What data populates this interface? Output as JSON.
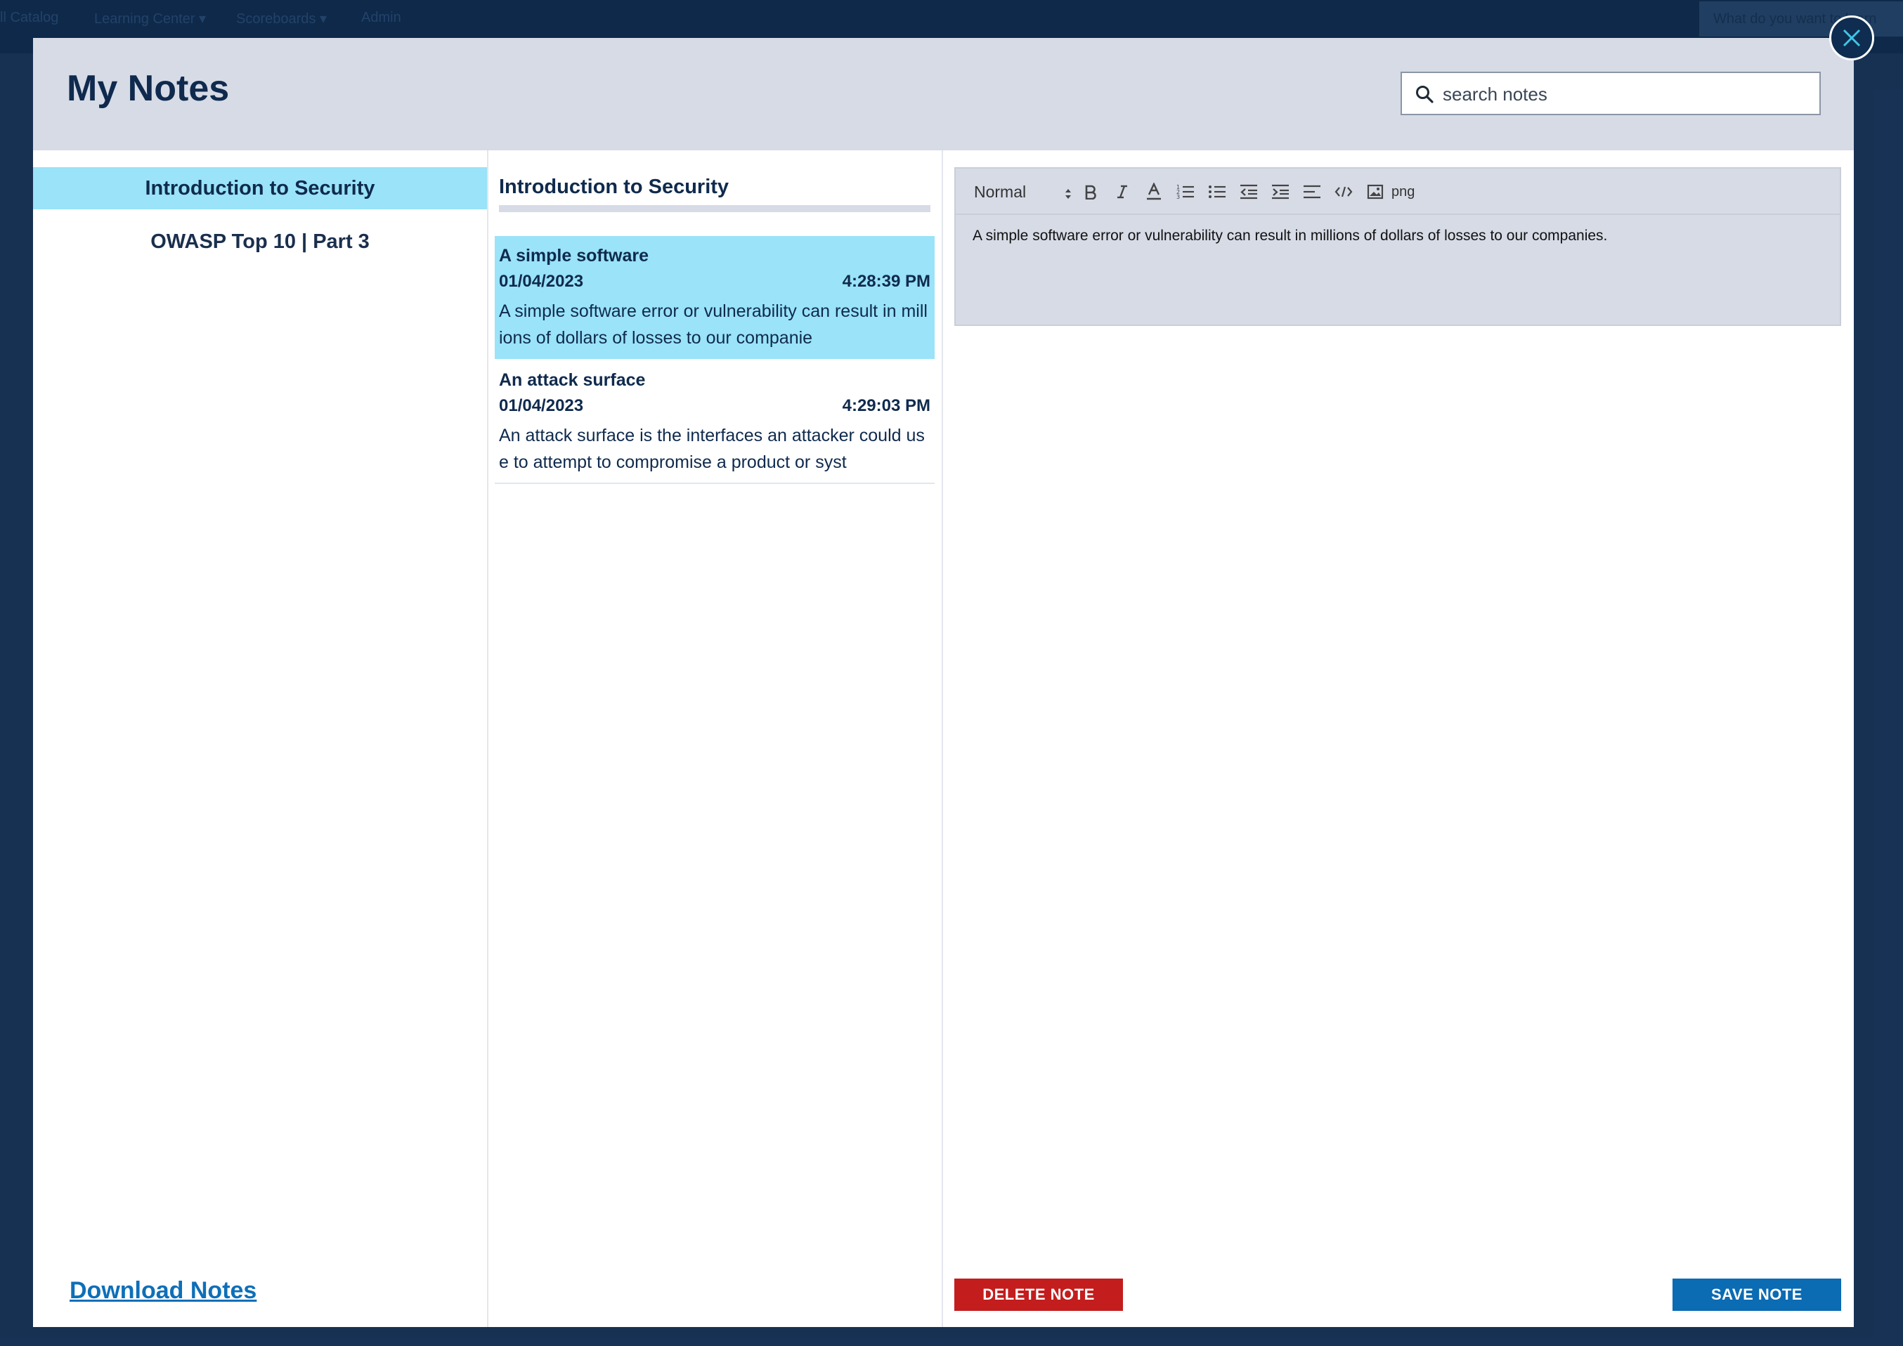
{
  "background_nav": {
    "items": [
      "ll Catalog",
      "Learning Center ▾",
      "Scoreboards ▾",
      "Admin"
    ],
    "search_placeholder": "What do you want to learn"
  },
  "modal": {
    "title": "My Notes",
    "search": {
      "placeholder": "search notes",
      "value": ""
    },
    "close_icon": "close-icon"
  },
  "courses": {
    "items": [
      {
        "label": "Introduction to Security",
        "active": true
      },
      {
        "label": "OWASP Top 10 | Part 3",
        "active": false
      }
    ],
    "download_label": "Download Notes"
  },
  "notes_list": {
    "heading": "Introduction to Security",
    "items": [
      {
        "title": "A simple software",
        "date": "01/04/2023",
        "time": "4:28:39 PM",
        "preview": "A simple software error or vulnerability can result in millions of dollars of losses to our companie",
        "selected": true
      },
      {
        "title": "An attack surface",
        "date": "01/04/2023",
        "time": "4:29:03 PM",
        "preview": "An attack surface is the interfaces an attacker could use to attempt to compromise a product or syst",
        "selected": false
      }
    ]
  },
  "editor": {
    "format_select": "Normal",
    "toolbar_icons": [
      "bold-icon",
      "italic-icon",
      "text-color-icon",
      "ordered-list-icon",
      "bullet-list-icon",
      "outdent-icon",
      "indent-icon",
      "align-icon",
      "code-icon",
      "image-icon"
    ],
    "png_label": "png",
    "content": "A simple software error or vulnerability can result in millions of dollars of losses to our companies."
  },
  "actions": {
    "delete_label": "DELETE NOTE",
    "save_label": "SAVE NOTE"
  },
  "colors": {
    "accent": "#9ae3f8",
    "header_bg": "#d6dbe6",
    "delete": "#c31d1d",
    "save": "#0b6bb3",
    "title_text": "#0f2a4d"
  }
}
